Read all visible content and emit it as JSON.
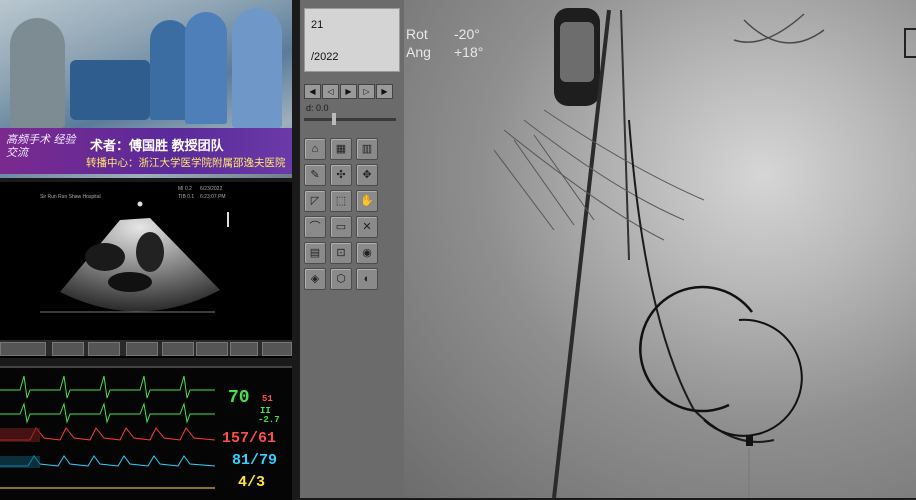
{
  "surgery_feed": {
    "logo_text": "高频手术 经验交流",
    "surgeon_line": "术者：傅国胜 教授团队",
    "center_line": "转播中心：浙江大学医学院附属邵逸夫医院"
  },
  "echo_panel": {
    "hospital": "Sir Run Run Shaw Hospital",
    "date": "6/23/2022",
    "time": "6:23:07 PM",
    "tib": "TIB 0.1",
    "mi": "MI 0.2"
  },
  "monitor": {
    "hr": "70",
    "st_label": "II",
    "st_value": "-2.7",
    "spo2_small": "51",
    "bp1": "157/61",
    "bp2": "81/79",
    "bp3": "4/3"
  },
  "control_panel": {
    "info_line1": "21",
    "info_line2": "/2022",
    "speed_label": "d: 0.0",
    "tools": [
      "⌂",
      "▦",
      "▥",
      "✎",
      "✣",
      "✥",
      "◸",
      "⬚",
      "✋",
      "⌒",
      "▭",
      "✕",
      "▤",
      "⊡",
      "◉",
      "◈",
      "⬡",
      "◐"
    ]
  },
  "fluoro": {
    "rot_label": "Rot",
    "rot_value": "-20°",
    "ang_label": "Ang",
    "ang_value": "+18°"
  }
}
